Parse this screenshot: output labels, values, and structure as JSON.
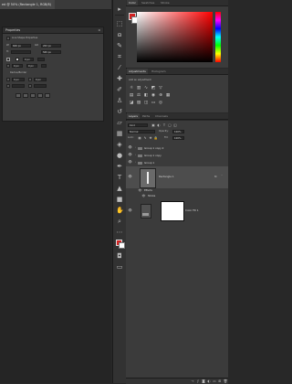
{
  "document": {
    "tab_title": "ed @ 50% (Rectangle 1, RGB/8)",
    "close_glyph": "×"
  },
  "properties": {
    "title": "Properties",
    "menu_glyph": "≡",
    "layer_label": "Live Shape Properties",
    "w_label": "W:",
    "w_value": "606 px",
    "x_label": "GO",
    "x_value": "263 px",
    "h_label": "H:",
    "y_value": "565 px",
    "stroke_value": "0 px",
    "radius_value": "0 px",
    "radius_value_2": "0 px",
    "corner_label": "Radius/Border",
    "corner_value_1": "0 px",
    "corner_value_2": "0 px"
  },
  "tools": [
    "move-tool-icon",
    "marquee-tool-icon",
    "lasso-tool-icon",
    "quick-select-tool-icon",
    "crop-tool-icon",
    "eyedropper-tool-icon",
    "healing-brush-icon",
    "brush-tool-icon",
    "clone-stamp-icon",
    "history-brush-icon",
    "eraser-tool-icon",
    "gradient-tool-icon",
    "blur-tool-icon",
    "dodge-tool-icon",
    "pen-tool-icon",
    "type-tool-icon",
    "path-select-icon",
    "shape-tool-icon",
    "hand-tool-icon",
    "zoom-tool-icon",
    "more-tools-icon",
    "color-swatch-icon",
    "quick-mask-icon",
    "screen-mode-icon"
  ],
  "color_panel": {
    "tabs": [
      "Color",
      "Swatches",
      "Stroke"
    ],
    "fg_color": "#d42121",
    "bg_color": "#ffffff"
  },
  "adjustments_panel": {
    "tabs": [
      "Adjustments",
      "Histogram"
    ],
    "subtitle": "Add an adjustment"
  },
  "layers_panel": {
    "tabs": [
      "Layers",
      "Paths",
      "Channels"
    ],
    "kind_label": "Kind",
    "blend_mode": "Normal",
    "opacity_label": "Opacity:",
    "opacity_value": "100%",
    "lock_label": "Lock:",
    "fill_label": "Fill:",
    "fill_value": "100%",
    "layers": [
      {
        "name": "Group 1 copy 2",
        "type": "group"
      },
      {
        "name": "Group 1 copy",
        "type": "group"
      },
      {
        "name": "Group 1",
        "type": "group"
      },
      {
        "name": "Rectangle 1",
        "type": "shape",
        "fx": "fx"
      },
      {
        "name": "Effects",
        "type": "effect"
      },
      {
        "name": "Stroke",
        "type": "effect"
      },
      {
        "name": "Color Fill 1",
        "type": "fill"
      }
    ]
  }
}
